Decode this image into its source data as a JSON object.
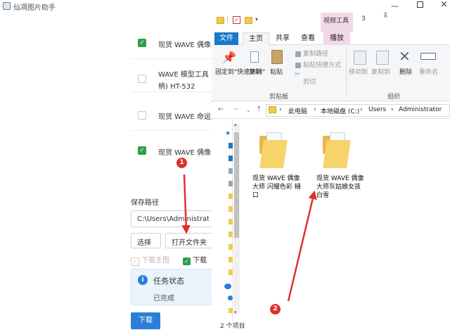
{
  "app": {
    "title": "仙凋图片助手",
    "items": [
      {
        "label": "现货 WAVE 偶像",
        "checked": true
      },
      {
        "label": "WAVE 模型工具",
        "label2": "柄) HT-532",
        "checked": false
      },
      {
        "label": "现货 WAVE 命运",
        "checked": false
      },
      {
        "label": "现货 WAVE 偶像",
        "checked": true
      }
    ],
    "save_path_label": "保存路径",
    "save_path_value": "C:\\Users\\Administrator",
    "choose_button": "选择",
    "open_folder_button": "打开文件夹",
    "option_thumbnail": "下载主图",
    "option_cover": "下载",
    "task_title": "任务状态",
    "task_status": "已完成",
    "download_button": "下载"
  },
  "explorer": {
    "context_tab_label": "视频工具",
    "window_number": "3",
    "tabs": [
      "文件",
      "主页",
      "共享",
      "查看",
      "播放"
    ],
    "ribbon": {
      "pin_label": "固定到\"快速访问\"",
      "copy_label": "复制",
      "paste_label": "粘贴",
      "copy_path_label": "复制路径",
      "paste_shortcut_label": "粘贴快捷方式",
      "cut_label": "剪切",
      "clipboard_group_label": "剪贴板",
      "move_to_label": "移动到",
      "copy_to_label": "复制到",
      "delete_label": "删除",
      "rename_label": "重命名",
      "organize_group_label": "组织"
    },
    "breadcrumbs": [
      "此电脑",
      "本地磁盘 (C:)",
      "Users",
      "Administrator"
    ],
    "folders": [
      {
        "name": "现货 WAVE 偶像大师 闪耀色彩 樋口"
      },
      {
        "name": "现货 WAVE 偶像大师灰姑娘女孩 白雪"
      }
    ],
    "status_count": "2 个项目"
  },
  "annotations": {
    "badge_1": "1",
    "badge_2": "2",
    "arrow_color": "#e0302b"
  },
  "colors": {
    "file_tab": "#1979ca",
    "context_tab": "#f3d9e8",
    "checkbox_on": "#2e9d4f",
    "primary_button": "#2b7fd8",
    "folder_yellow": "#f7d36c"
  }
}
